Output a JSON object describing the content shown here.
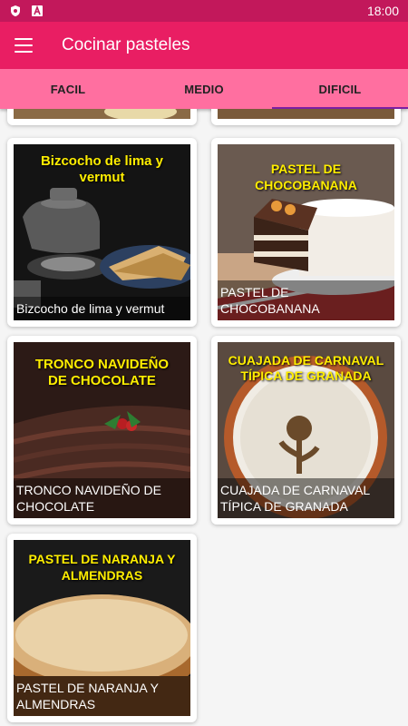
{
  "status": {
    "time": "18:00"
  },
  "app": {
    "title": "Cocinar pasteles"
  },
  "tabs": [
    {
      "label": "FACIL",
      "active": false
    },
    {
      "label": "MEDIO",
      "active": false
    },
    {
      "label": "DIFICIL",
      "active": true
    }
  ],
  "recipes": [
    {
      "headline": "Bizcocho de lima y vermut",
      "caption": "Bizcocho de lima y vermut"
    },
    {
      "headline": "PASTEL DE CHOCOBANANA",
      "caption": "PASTEL DE CHOCOBANANA"
    },
    {
      "headline": "TRONCO NAVIDEÑO DE CHOCOLATE",
      "caption": "TRONCO NAVIDEÑO DE CHOCOLATE"
    },
    {
      "headline": "CUAJADA DE CARNAVAL TÍPICA DE GRANADA",
      "caption": "CUAJADA DE CARNAVAL TÍPICA DE GRANADA"
    },
    {
      "headline": "PASTEL DE NARANJA Y ALMENDRAS",
      "caption": "PASTEL DE NARANJA Y ALMENDRAS"
    }
  ],
  "colors": {
    "status_bar": "#c2185b",
    "app_bar": "#e91e63",
    "tabs": "#ff6fa0",
    "tab_indicator": "#7b1fa2",
    "headline_text": "#ffee00"
  }
}
